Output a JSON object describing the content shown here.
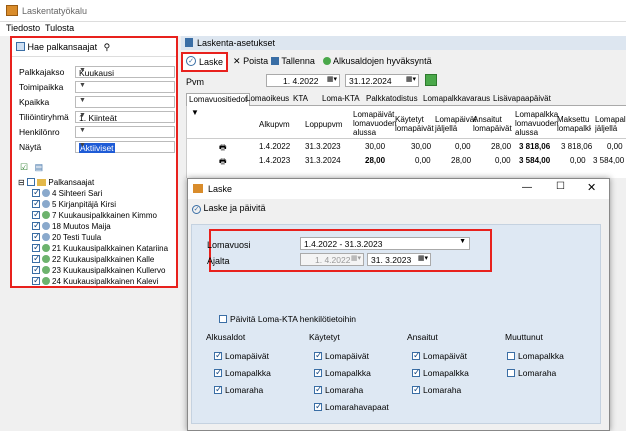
{
  "app": {
    "title": "Laskentatyökalu"
  },
  "menu": [
    "Tiedosto",
    "Tulosta"
  ],
  "left": {
    "search_label": "Hae palkansaajat",
    "filters": [
      {
        "label": "Palkkajakso",
        "value": "Kuukausi"
      },
      {
        "label": "Toimipaikka",
        "value": ""
      },
      {
        "label": "Kpaikka",
        "value": ""
      },
      {
        "label": "Tiliöintiryhmä",
        "value": "1. Kiinteät"
      },
      {
        "label": "Henkilönro",
        "value": ""
      },
      {
        "label": "Näytä",
        "value": "Aktiiviset"
      }
    ],
    "tree_root": "Palkansaajat",
    "people": [
      "4 Sihteeri Sari",
      "5 Kirjanpitäjä Kirsi",
      "7 Kuukausipalkkainen Kimmo",
      "18 Muutos Maija",
      "20 Testi Tuula",
      "21 Kuukausipalkkainen Katariina",
      "22 Kuukausipalkkainen Kalle",
      "23 Kuukausipalkkainen Kullervo",
      "24 Kuukausipalkkainen Kalevi"
    ]
  },
  "right": {
    "header": "Laskenta-asetukset",
    "toolbar": {
      "laske": "Laske",
      "poista": "Poista",
      "tallenna": "Tallenna",
      "alkusaldot": "Alkusaldojen hyväksyntä"
    },
    "pvm_label": "Pvm",
    "date_from": "1. 4.2022",
    "date_to": "31.12.2024",
    "tabs": [
      "Lomavuositiedot",
      "Lomaoikeus",
      "KTA",
      "Loma-KTA",
      "Palkkatodistus",
      "Lomapalkkavaraus",
      "Lisävapaapäivät"
    ],
    "columns": [
      "Alkupvm",
      "Loppupvm",
      "Lomapäivät lomavuoden alussa",
      "Käytetyt lomapäivät",
      "Lomapäivät jäljellä",
      "Ansaitut lomapäivät",
      "Lomapalkka lomavuoden alussa",
      "Maksettu lomapalkka",
      "Lomapalkka jäljellä"
    ],
    "rows": [
      [
        "1.4.2022",
        "31.3.2023",
        "30,00",
        "30,00",
        "0,00",
        "28,00",
        "3 818,06",
        "3 818,06",
        "0,00"
      ],
      [
        "1.4.2023",
        "31.3.2024",
        "28,00",
        "0,00",
        "28,00",
        "0,00",
        "3 584,00",
        "0,00",
        "3 584,00"
      ]
    ]
  },
  "dialog": {
    "title": "Laske",
    "action": "Laske ja päivitä",
    "lomavuosi_label": "Lomavuosi",
    "lomavuosi_value": "1.4.2022 - 31.3.2023",
    "ajalta_label": "Ajalta",
    "ajalta_from": "1. 4.2022",
    "ajalta_to": "31. 3.2023",
    "update_kta": "Päivitä Loma-KTA henkilötietoihin",
    "groups": [
      {
        "title": "Alkusaldot",
        "items": [
          "Lomapäivät",
          "Lomapalkka",
          "Lomaraha"
        ]
      },
      {
        "title": "Käytetyt",
        "items": [
          "Lomapäivät",
          "Lomapalkka",
          "Lomaraha",
          "Lomarahavapaat"
        ]
      },
      {
        "title": "Ansaitut",
        "items": [
          "Lomapäivät",
          "Lomapalkka",
          "Lomaraha"
        ]
      },
      {
        "title": "Muuttunut",
        "items": [
          "Lomapalkka",
          "Lomaraha"
        ]
      }
    ]
  },
  "colors": {
    "accent_red": "#e8211d",
    "panel_blue": "#dee8f3"
  }
}
